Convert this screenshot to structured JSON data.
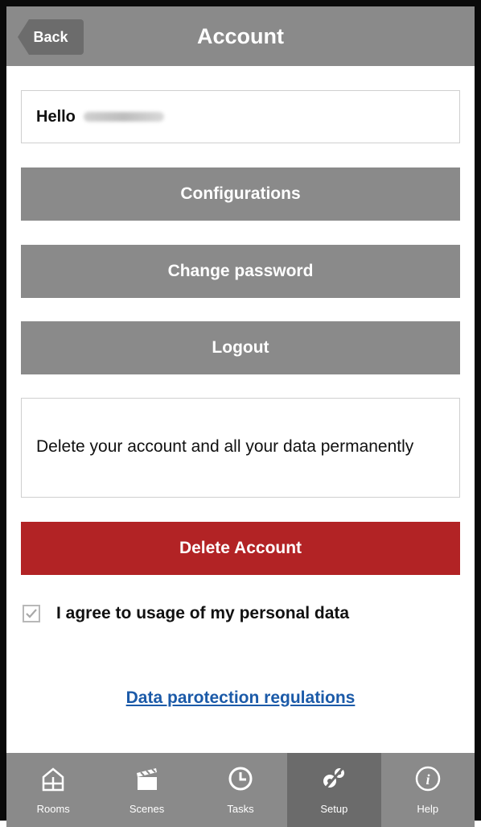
{
  "header": {
    "back_label": "Back",
    "title": "Account"
  },
  "greeting": {
    "text": "Hello"
  },
  "buttons": {
    "configurations": "Configurations",
    "change_password": "Change password",
    "logout": "Logout",
    "delete_account": "Delete Account"
  },
  "delete_info": {
    "text": "Delete your account and all your data permanently"
  },
  "consent": {
    "checked": true,
    "label": "I agree to usage of my personal data"
  },
  "links": {
    "data_protection": "Data parotection regulations"
  },
  "tabbar": {
    "items": [
      {
        "label": "Rooms",
        "icon": "house-icon"
      },
      {
        "label": "Scenes",
        "icon": "clapperboard-icon"
      },
      {
        "label": "Tasks",
        "icon": "clock-icon"
      },
      {
        "label": "Setup",
        "icon": "setup-gears-icon",
        "active": true
      },
      {
        "label": "Help",
        "icon": "info-icon"
      }
    ]
  },
  "colors": {
    "header_bg": "#8a8a8a",
    "button_bg": "#8a8a8a",
    "danger": "#b22325",
    "link": "#1b5aa8",
    "tab_active": "#6b6b6b"
  }
}
